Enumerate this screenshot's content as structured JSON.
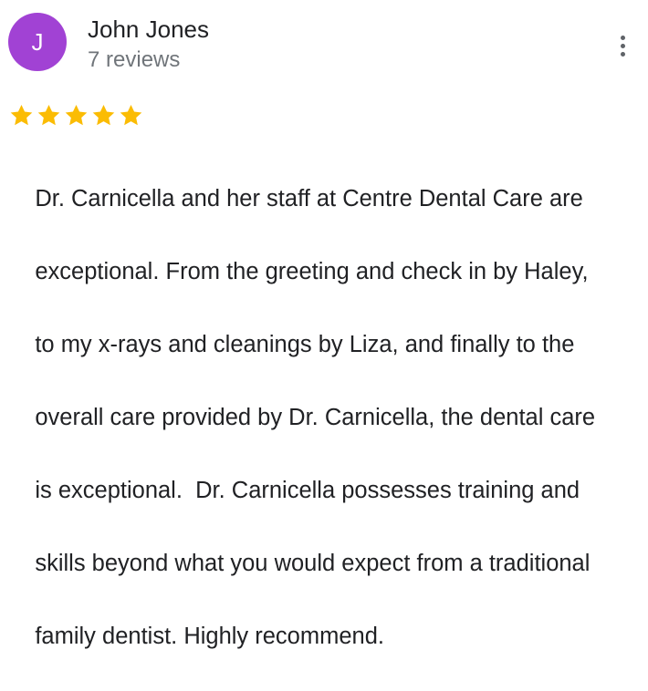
{
  "review": {
    "author": {
      "initial": "J",
      "name": "John Jones",
      "review_count": "7 reviews",
      "avatar_color": "#a142d4"
    },
    "rating": {
      "value": 5,
      "max": 5,
      "star_color": "#fbbc04"
    },
    "more_options_icon": "more-vert-icon",
    "lines": [
      "Dr. Carnicella and her staff at Centre Dental Care are",
      "exceptional. From the greeting and check in by Haley,",
      "to my x-rays and cleanings by Liza, and finally to the",
      "overall care provided by Dr. Carnicella, the dental care",
      "is exceptional.  Dr. Carnicella possesses training and",
      "skills beyond what you would expect from a traditional",
      "family dentist. Highly recommend."
    ]
  }
}
